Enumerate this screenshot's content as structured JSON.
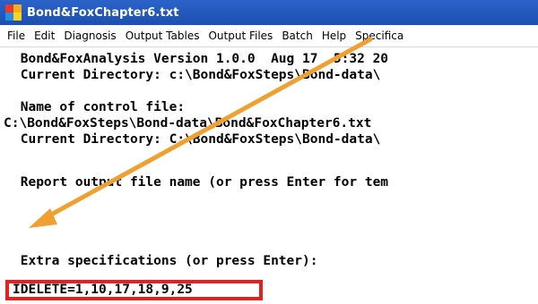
{
  "window": {
    "title": "Bond&FoxChapter6.txt"
  },
  "menu": {
    "items": [
      "File",
      "Edit",
      "Diagnosis",
      "Output Tables",
      "Output Files",
      "Batch",
      "Help",
      "Specifica"
    ]
  },
  "console": {
    "lines": [
      " Bond&FoxAnalysis Version 1.0.0  Aug 17  5:32 20",
      " Current Directory: c:\\Bond&FoxSteps\\Bond-data\\",
      "",
      " Name of control file:",
      "C:\\Bond&FoxSteps\\Bond-data\\Bond&FoxChapter6.txt",
      " Current Directory: C:\\Bond&FoxSteps\\Bond-data\\",
      "",
      " Report output file name (or press Enter for tem",
      "",
      "",
      " Extra specifications (or press Enter):"
    ],
    "input_value": "IDELETE=1,10,17,18,9,25"
  },
  "colors": {
    "titlebar": "#1c4fb0",
    "highlight": "#e52020",
    "arrow": "#f0a030"
  }
}
